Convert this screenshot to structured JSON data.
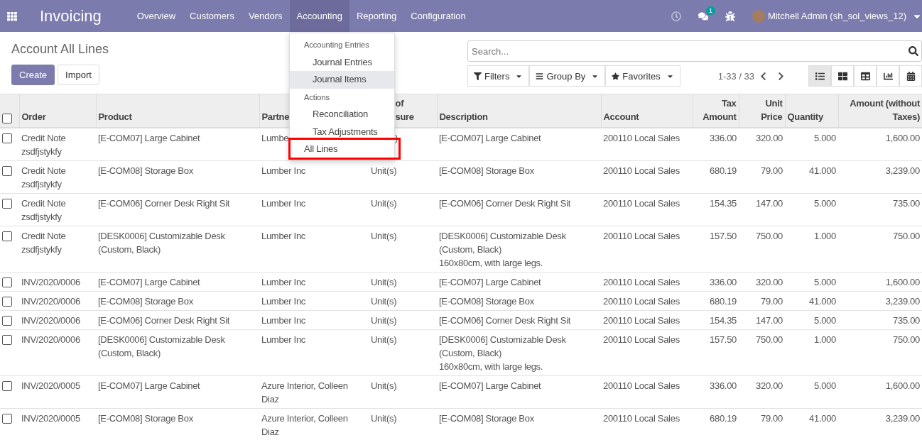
{
  "navbar": {
    "app_title": "Invoicing",
    "menu": [
      {
        "label": "Overview",
        "selected": false
      },
      {
        "label": "Customers",
        "selected": false
      },
      {
        "label": "Vendors",
        "selected": false
      },
      {
        "label": "Accounting",
        "selected": true
      },
      {
        "label": "Reporting",
        "selected": false
      },
      {
        "label": "Configuration",
        "selected": false
      }
    ],
    "message_count": "1",
    "user": "Mitchell Admin (sh_sol_views_12)"
  },
  "dropdown": [
    {
      "kind": "header",
      "label": "Accounting Entries"
    },
    {
      "kind": "item",
      "label": "Journal Entries",
      "selected": false,
      "outlined": false
    },
    {
      "kind": "item",
      "label": "Journal Items",
      "selected": true,
      "outlined": false
    },
    {
      "kind": "header",
      "label": "Actions"
    },
    {
      "kind": "item",
      "label": "Reconciliation",
      "selected": false,
      "outlined": false
    },
    {
      "kind": "item",
      "label": "Tax Adjustments",
      "selected": false,
      "outlined": false
    },
    {
      "kind": "top",
      "label": "All Lines",
      "selected": false,
      "outlined": true
    }
  ],
  "page_title": "Account All Lines",
  "buttons": [
    "Create",
    "Import"
  ],
  "search": {
    "placeholder": "Search..."
  },
  "filters": [
    "Filters",
    "Group By",
    "Favorites"
  ],
  "pager": "1-33 / 33",
  "views": [
    {
      "kind": "list",
      "selected": true
    },
    {
      "kind": "kanban",
      "selected": false
    },
    {
      "kind": "pivot",
      "selected": false
    },
    {
      "kind": "graph",
      "selected": false
    },
    {
      "kind": "calendar",
      "selected": false
    }
  ],
  "table": {
    "all_checked": false,
    "columns": [
      {
        "label": "Order",
        "kind": "text",
        "under_menu": false
      },
      {
        "label": "Product",
        "kind": "text",
        "under_menu": false
      },
      {
        "label": "Partne",
        "kind": "text",
        "under_menu": false
      },
      {
        "label": "of\nsure",
        "kind": "text",
        "under_menu": true
      },
      {
        "label": "Description",
        "kind": "text",
        "under_menu": false
      },
      {
        "label": "Account",
        "kind": "text",
        "under_menu": false
      },
      {
        "label": "Tax\nAmount",
        "kind": "number",
        "under_menu": false
      },
      {
        "label": "Unit\nPrice",
        "kind": "number",
        "under_menu": false
      },
      {
        "label": "Quantity",
        "kind": "count",
        "under_menu": false
      },
      {
        "label": "Amount (without\nTaxes)",
        "kind": "number",
        "under_menu": false
      }
    ],
    "rows": [
      {
        "checked": false,
        "under_menu": true,
        "cells": [
          "Credit Note\nzsdfjstykfy",
          "[E-COM07] Large Cabinet",
          "Lumbe",
          ")",
          "[E-COM07] Large Cabinet",
          "200110 Local Sales",
          "336.00",
          "320.00",
          "5.000",
          "1,600.00"
        ]
      },
      {
        "checked": false,
        "cells": [
          "Credit Note\nzsdfjstykfy",
          "[E-COM08] Storage Box",
          "Lumber Inc",
          "Unit(s)",
          "[E-COM08] Storage Box",
          "200110 Local Sales",
          "680.19",
          "79.00",
          "41.000",
          "3,239.00"
        ]
      },
      {
        "checked": false,
        "cells": [
          "Credit Note\nzsdfjstykfy",
          "[E-COM06] Corner Desk Right Sit",
          "Lumber Inc",
          "Unit(s)",
          "[E-COM06] Corner Desk Right Sit",
          "200110 Local Sales",
          "154.35",
          "147.00",
          "5.000",
          "735.00"
        ]
      },
      {
        "checked": false,
        "cells": [
          "Credit Note\nzsdfjstykfy",
          "[DESK0006] Customizable Desk\n(Custom, Black)",
          "Lumber Inc",
          "Unit(s)",
          "[DESK0006] Customizable Desk\n(Custom, Black)\n160x80cm, with large legs.",
          "200110 Local Sales",
          "157.50",
          "750.00",
          "1.000",
          "750.00"
        ]
      },
      {
        "checked": false,
        "cells": [
          "INV/2020/0006",
          "[E-COM07] Large Cabinet",
          "Lumber Inc",
          "Unit(s)",
          "[E-COM07] Large Cabinet",
          "200110 Local Sales",
          "336.00",
          "320.00",
          "5.000",
          "1,600.00"
        ]
      },
      {
        "checked": false,
        "cells": [
          "INV/2020/0006",
          "[E-COM08] Storage Box",
          "Lumber Inc",
          "Unit(s)",
          "[E-COM08] Storage Box",
          "200110 Local Sales",
          "680.19",
          "79.00",
          "41.000",
          "3,239.00"
        ]
      },
      {
        "checked": false,
        "cells": [
          "INV/2020/0006",
          "[E-COM06] Corner Desk Right Sit",
          "Lumber Inc",
          "Unit(s)",
          "[E-COM06] Corner Desk Right Sit",
          "200110 Local Sales",
          "154.35",
          "147.00",
          "5.000",
          "735.00"
        ]
      },
      {
        "checked": false,
        "cells": [
          "INV/2020/0006",
          "[DESK0006] Customizable Desk\n(Custom, Black)",
          "Lumber Inc",
          "Unit(s)",
          "[DESK0006] Customizable Desk\n(Custom, Black)\n160x80cm, with large legs.",
          "200110 Local Sales",
          "157.50",
          "750.00",
          "1.000",
          "750.00"
        ]
      },
      {
        "checked": false,
        "cells": [
          "INV/2020/0005",
          "[E-COM07] Large Cabinet",
          "Azure Interior, Colleen\nDiaz",
          "Unit(s)",
          "[E-COM07] Large Cabinet",
          "200110 Local Sales",
          "336.00",
          "320.00",
          "5.000",
          "1,600.00"
        ]
      },
      {
        "checked": false,
        "cells": [
          "INV/2020/0005",
          "[E-COM08] Storage Box",
          "Azure Interior, Colleen\nDiaz",
          "Unit(s)",
          "[E-COM08] Storage Box",
          "200110 Local Sales",
          "680.19",
          "79.00",
          "41.000",
          "3,239.00"
        ]
      }
    ]
  }
}
